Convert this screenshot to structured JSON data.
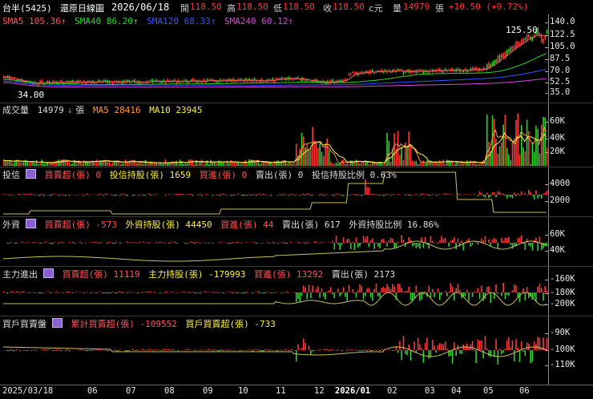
{
  "top": {
    "stock": "台半(5425)",
    "chart_type": "還原日線圖",
    "date": "2026/06/18",
    "open_label": "開",
    "open": "118.50",
    "high_label": "高",
    "high": "118.50",
    "low_label": "低",
    "low": "118.50",
    "close_label": "收",
    "close": "118.50",
    "currency": "c元",
    "vol_label": "量",
    "vol": "14979",
    "vol_unit": "張",
    "change": "+10.50 (+9.72%)"
  },
  "ma": {
    "sma5": "SMA5 105.36↑",
    "sma40": "SMA40 86.20↑",
    "sma120": "SMA120 68.33↑",
    "sma240": "SMA240 60.12↑"
  },
  "price": {
    "high_mark": "125.50",
    "low_mark": "34.00",
    "yticks": [
      "140.0",
      "122.5",
      "105.0",
      "87.5",
      "70.0",
      "52.5",
      "35.0"
    ]
  },
  "volume": {
    "label": "成交量",
    "value": "14979",
    "unit": "張",
    "ma5": "MA5 28416",
    "ma10": "MA10 23945",
    "yticks": [
      "60K",
      "40K",
      "20K"
    ]
  },
  "trust": {
    "label": "投信",
    "buy_sell": "買賣超(張) 0",
    "hold": "投信持股(張) 1659",
    "buy": "買進(張) 0",
    "sell": "賣出(張) 0",
    "ratio": "投信持股比例 0.63%",
    "yticks": [
      "4000",
      "2000"
    ]
  },
  "foreign": {
    "label": "外資",
    "buy_sell": "買賣超(張) -573",
    "hold": "外資持股(張) 44450",
    "buy": "買進(張) 44",
    "sell": "賣出(張) 617",
    "ratio": "外資持股比例 16.86%",
    "yticks": [
      "60K",
      "40K"
    ]
  },
  "main_force": {
    "label": "主力進出",
    "buy_sell": "買賣超(張) 11119",
    "hold": "主力持股(張) -179993",
    "buy": "買進(張) 13292",
    "sell": "賣出(張) 2173",
    "yticks": [
      "-160K",
      "-180K",
      "-200K"
    ]
  },
  "broker": {
    "label": "買戶買賣盤",
    "cum": "累計買賣超(張) -109552",
    "buy_sell": "買戶買賣超(張) -733",
    "yticks": [
      "-90K",
      "-100K",
      "-110K"
    ]
  },
  "xaxis": [
    "2025/03/18",
    "06",
    "07",
    "08",
    "09",
    "10",
    "11",
    "12",
    "2026/01",
    "02",
    "03",
    "04",
    "05",
    "06"
  ],
  "colors": {
    "up": "#ff3838",
    "down": "#2fd22f",
    "sma5": "#ff5555",
    "sma40": "#22dd22",
    "sma120": "#3355ff",
    "sma240": "#dd44dd",
    "line": "#c8c05a"
  }
}
